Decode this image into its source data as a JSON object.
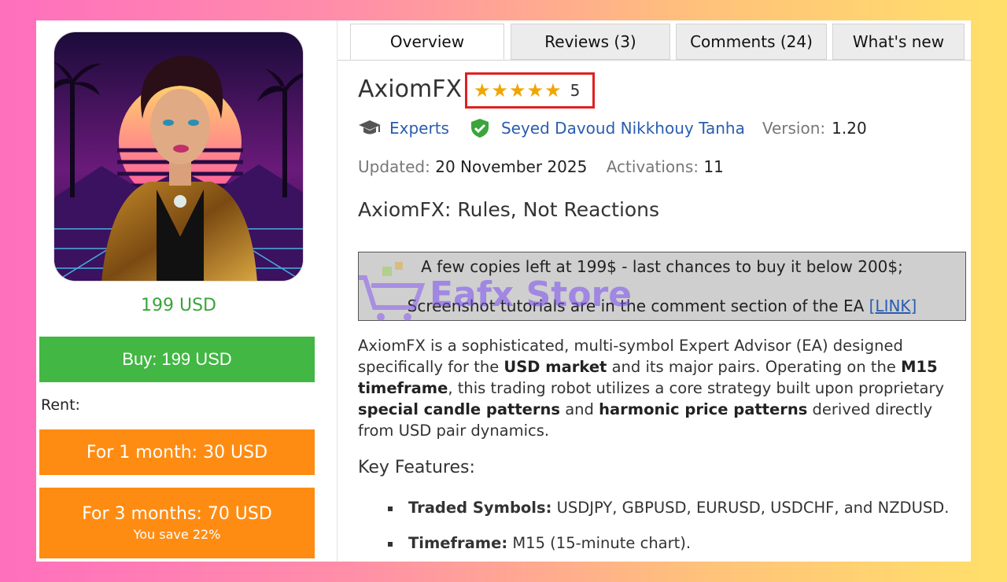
{
  "product": {
    "price_label": "199 USD",
    "buy_label": "Buy: 199 USD",
    "rent_label": "Rent:",
    "rent_options": [
      {
        "label": "For 1 month: 30 USD"
      },
      {
        "label": "For 3 months: 70 USD",
        "save": "You save 22%"
      }
    ]
  },
  "tabs": [
    {
      "label": "Overview",
      "active": true
    },
    {
      "label": "Reviews (3)"
    },
    {
      "label": "Comments (24)"
    },
    {
      "label": "What's new"
    }
  ],
  "header": {
    "title": "AxiomFX",
    "rating": {
      "value": 5,
      "stars": "★★★★★",
      "text": "5"
    },
    "category": "Experts",
    "author": "Seyed Davoud Nikkhouy Tanha",
    "version_label": "Version:",
    "version": "1.20",
    "updated_label": "Updated:",
    "updated": "20 November 2025",
    "activations_label": "Activations:",
    "activations": "11"
  },
  "subtitle": "AxiomFX: Rules, Not Reactions",
  "notice": {
    "line1": "A few copies left at 199$ - last chances to buy it below 200$;",
    "line2": "Screenshot tutorials are in the comment section of the EA",
    "link": "[LINK]"
  },
  "watermark": "Eafx Store",
  "description": {
    "p1_a": "AxiomFX is a sophisticated, multi-symbol Expert Advisor (EA) designed specifically for the ",
    "p1_b": "USD market",
    "p1_c": " and its major pairs. Operating on the ",
    "p1_d": "M15 timeframe",
    "p1_e": ", this trading robot utilizes a core strategy built upon proprietary ",
    "p1_f": "special candle patterns",
    "p1_g": " and ",
    "p1_h": "harmonic price patterns",
    "p1_i": " derived directly from USD pair dynamics."
  },
  "features": {
    "heading": "Key Features:",
    "items": [
      {
        "label": "Traded Symbols:",
        "value": " USDJPY, GBPUSD, EURUSD, USDCHF, and NZDUSD."
      },
      {
        "label": "Timeframe:",
        "value": " M15 (15-minute chart)."
      }
    ]
  },
  "colors": {
    "buy": "#42b744",
    "rent": "#ff8c12",
    "link": "#2a5db0",
    "rating_border": "#e02020",
    "star": "#f0a500"
  }
}
